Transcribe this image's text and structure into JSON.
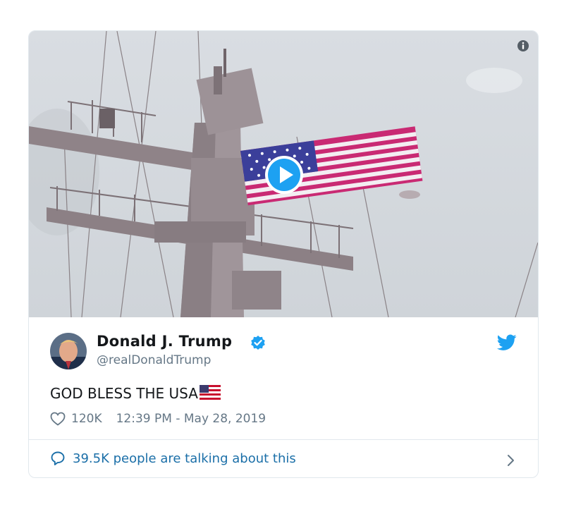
{
  "tweet": {
    "author_name": "Donald J. Trump",
    "author_handle": "@realDonaldTrump",
    "text": "GOD BLESS THE USA",
    "likes": "120K",
    "timestamp": "12:39 PM - May 28, 2019",
    "talking_text": "39.5K people are talking about this"
  },
  "icons": {
    "info": "info-icon",
    "play": "play-icon",
    "verified": "verified-badge-icon",
    "bird": "twitter-bird-icon",
    "heart": "heart-icon",
    "bubble": "speech-bubble-icon",
    "chevron": "chevron-right-icon",
    "flag_emoji": "us-flag-emoji"
  },
  "colors": {
    "brand_blue": "#1da1f2",
    "link_blue": "#1b6fa8",
    "secondary_text": "#657786",
    "primary_text": "#14171a",
    "border": "#e1e8ed"
  }
}
